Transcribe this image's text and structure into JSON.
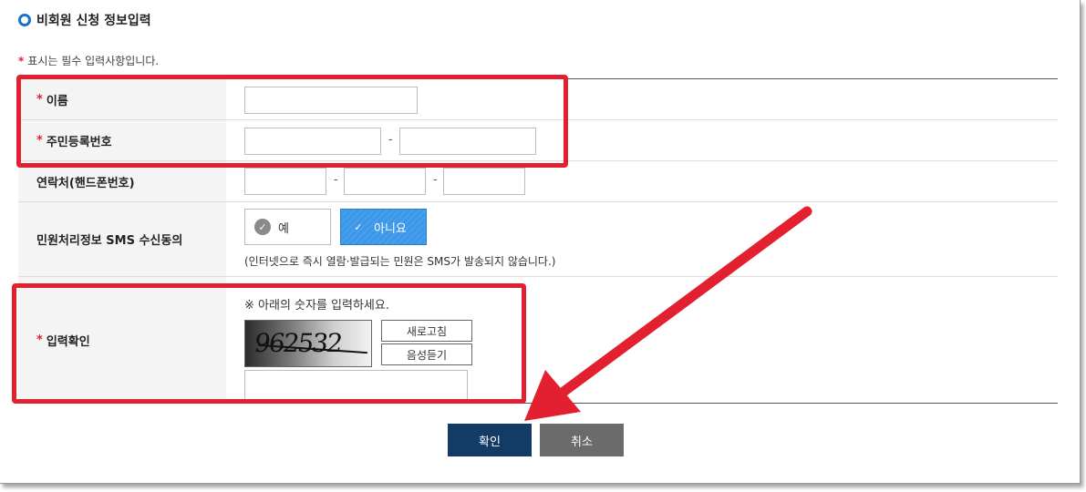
{
  "header": {
    "title": "비회원 신청 정보입력"
  },
  "required_note": {
    "star": "*",
    "text": "표시는 필수 입력사항입니다."
  },
  "form": {
    "name": {
      "star": "*",
      "label": "이름",
      "value": ""
    },
    "resident_no": {
      "star": "*",
      "label": "주민등록번호",
      "separator": "-",
      "part1": "",
      "part2": ""
    },
    "phone": {
      "label": "연락처(핸드폰번호)",
      "separator": "-",
      "part1": "",
      "part2": "",
      "part3": ""
    },
    "sms_consent": {
      "label": "민원처리정보 SMS 수신동의",
      "options": [
        {
          "label": "예",
          "selected": false
        },
        {
          "label": "아니요",
          "selected": true
        }
      ],
      "hint": "(인터넷으로 즉시 열람·발급되는 민원은 SMS가 발송되지 않습니다.)"
    },
    "captcha": {
      "star": "*",
      "label": "입력확인",
      "instruction": "※ 아래의 숫자를 입력하세요.",
      "image_text": "962532",
      "refresh_label": "새로고침",
      "audio_label": "음성듣기",
      "value": ""
    }
  },
  "actions": {
    "confirm_label": "확인",
    "cancel_label": "취소"
  },
  "annotation_color": "#e3202f",
  "accent_color": "#3b97e8"
}
